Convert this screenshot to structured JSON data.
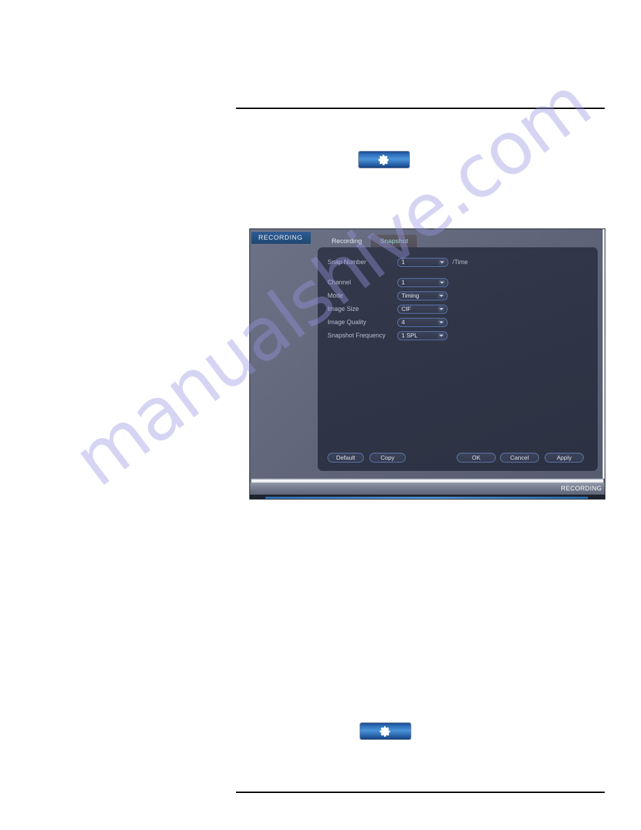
{
  "page": {
    "background": "#ffffff",
    "rule_color": "#000000",
    "watermark_text": "manualshive.com",
    "watermark_color": "#9696e1"
  },
  "gear_buttons": {
    "top": {
      "icon": "gear-icon",
      "accent": "#3a7dc4"
    },
    "bottom": {
      "icon": "gear-icon",
      "accent": "#3a7dc4"
    }
  },
  "dvr": {
    "title": "RECORDING",
    "title_badge_color": "#24507f",
    "tabs": [
      {
        "label": "Recording",
        "active": false
      },
      {
        "label": "Snapshot",
        "active": true
      }
    ],
    "form": {
      "rows": [
        {
          "label": "Snap Number",
          "value": "1",
          "suffix": "/Time"
        },
        {
          "label": "Channel",
          "value": "1",
          "suffix": ""
        },
        {
          "label": "Mode",
          "value": "Timing",
          "suffix": ""
        },
        {
          "label": "Image Size",
          "value": "CIF",
          "suffix": ""
        },
        {
          "label": "Image Quality",
          "value": "4",
          "suffix": ""
        },
        {
          "label": "Snapshot Frequency",
          "value": "1 SPL",
          "suffix": ""
        }
      ]
    },
    "buttons": {
      "default": "Default",
      "copy": "Copy",
      "ok": "OK",
      "cancel": "Cancel",
      "apply": "Apply"
    },
    "statusbar": {
      "label": "RECORDING"
    }
  }
}
